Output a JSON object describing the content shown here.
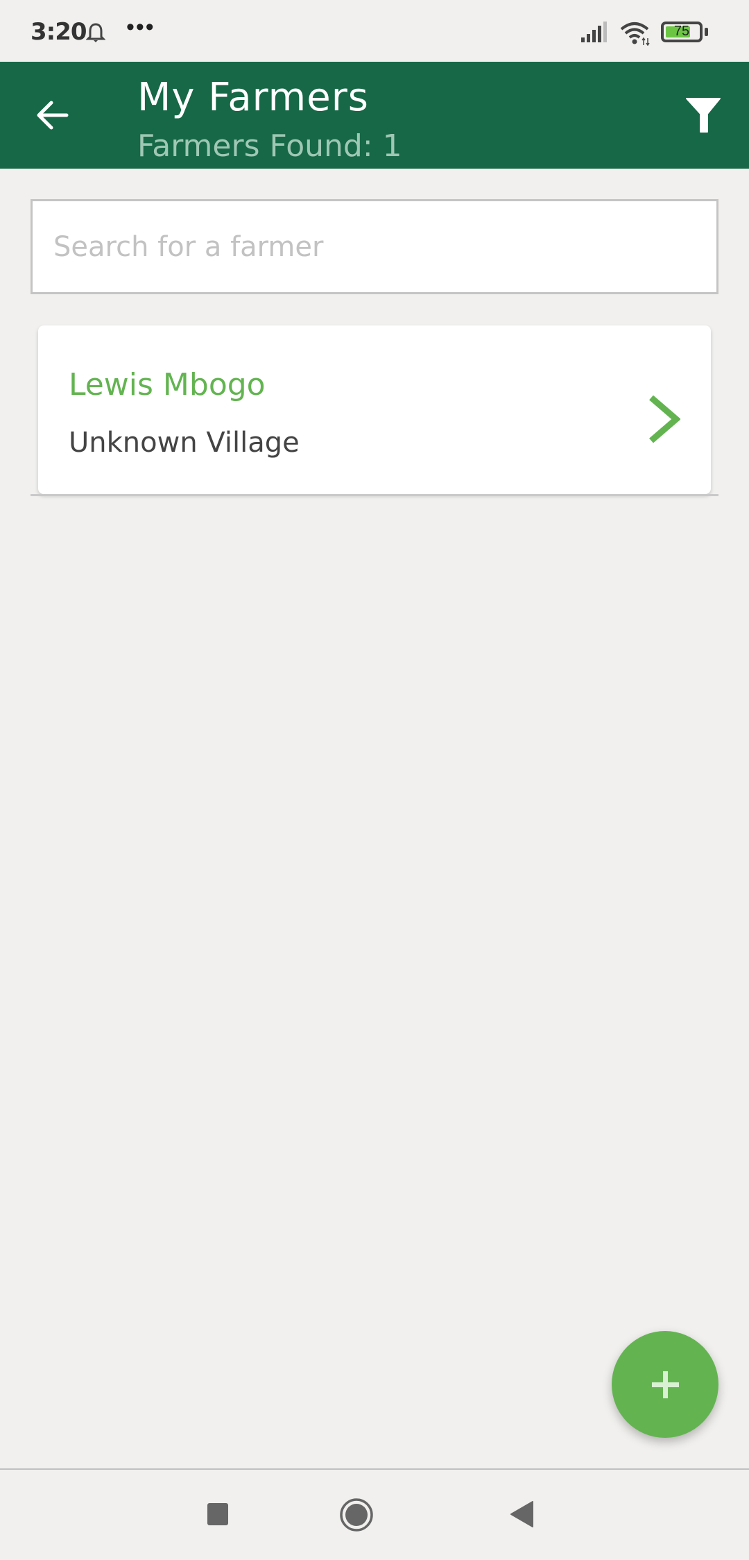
{
  "status_bar": {
    "time": "3:20",
    "overflow": "•••",
    "battery_level": "75",
    "battery_fraction": 0.75,
    "icons": [
      "bell-icon",
      "signal-icon",
      "wifi-icon",
      "battery-icon"
    ]
  },
  "app_bar": {
    "title": "My Farmers",
    "subtitle": "Farmers Found: 1",
    "back_icon": "arrow-left-icon",
    "filter_icon": "filter-icon",
    "color": "#166846"
  },
  "search": {
    "value": "",
    "placeholder": "Search for a farmer"
  },
  "farmers": [
    {
      "name": "Lewis Mbogo",
      "village": "Unknown Village"
    }
  ],
  "fab": {
    "icon": "plus-icon",
    "label": "+",
    "color": "#63b451"
  },
  "nav_bar": {
    "buttons": [
      "recent-apps",
      "home",
      "back"
    ]
  }
}
